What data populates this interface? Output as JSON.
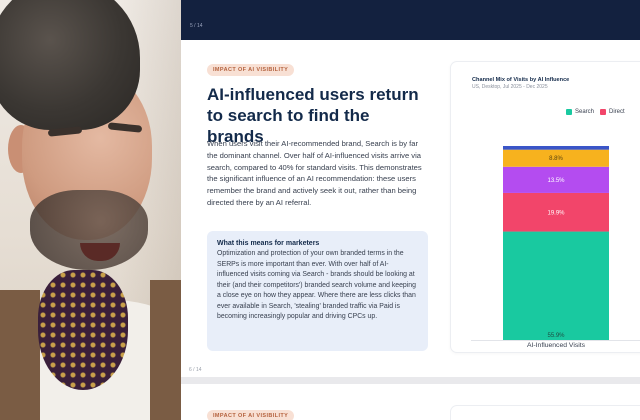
{
  "viewer": {
    "top_page_indicator": "5 / 14",
    "slide_page_indicator": "6 / 14"
  },
  "slide": {
    "tag": "IMPACT OF AI VISIBILITY",
    "title": "AI-influenced users return to search to find the brands",
    "body": "When users visit their AI-recommended brand, Search is by far the dominant channel. Over half of AI-influenced visits arrive via search, compared to 40% for standard visits. This demonstrates the significant influence of an AI recommendation: these users remember the brand and actively seek it out, rather than being directed there by an AI referral.",
    "callout": {
      "heading": "What this means for marketers",
      "text": "Optimization and protection of your own branded terms in the SERPs is more important than ever. With over half of AI-influenced visits coming via Search - brands should be looking at their (and their competitors') branded search volume and keeping a close eye on how they appear. Where there are less clicks than ever available in Search, 'stealing' branded traffic via Paid is becoming increasingly popular and driving CPCs up."
    }
  },
  "next_slide": {
    "tag": "IMPACT OF AI VISIBILITY"
  },
  "colors": {
    "search": "#19c9a0",
    "direct": "#f2456a",
    "purple": "#b44cf0",
    "orange": "#f7b21e",
    "blue": "#3a55c8"
  },
  "chart_data": {
    "type": "bar",
    "stacked": true,
    "title": "Channel Mix of Visits by AI Influence",
    "subtitle": "US, Desktop, Jul 2025 - Dec 2025",
    "categories": [
      "AI-Influenced Visits"
    ],
    "legend_position": "top-right",
    "ylim": [
      0,
      100
    ],
    "series": [
      {
        "name": "Search",
        "values": [
          55.9
        ],
        "color": "#19c9a0",
        "label": "55.9%"
      },
      {
        "name": "Direct",
        "values": [
          19.9
        ],
        "color": "#f2456a",
        "label": "19.9%"
      },
      {
        "values": [
          13.5
        ],
        "color": "#b44cf0",
        "label": "13.5%"
      },
      {
        "values": [
          8.8
        ],
        "color": "#f7b21e",
        "label": "8.8%"
      },
      {
        "values": [
          1.9
        ],
        "color": "#3a55c8",
        "label": ""
      }
    ]
  }
}
